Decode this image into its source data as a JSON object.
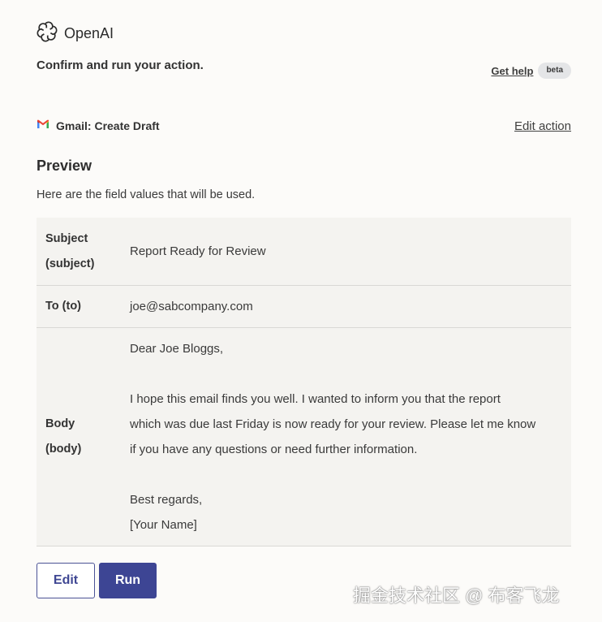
{
  "brand": {
    "name": "OpenAI",
    "icon": "openai-logo-icon"
  },
  "header": {
    "subtitle": "Confirm and run your action.",
    "help_link": "Get help",
    "beta_badge": "beta"
  },
  "action": {
    "icon": "gmail-icon",
    "title": "Gmail: Create Draft",
    "edit_link": "Edit action"
  },
  "preview": {
    "heading": "Preview",
    "description": "Here are the field values that will be used.",
    "fields": {
      "subject": {
        "label_line1": "Subject",
        "label_line2": "(subject)",
        "value": "Report Ready for Review"
      },
      "to": {
        "label": "To (to)",
        "value": "joe@sabcompany.com"
      },
      "body": {
        "label_line1": "Body",
        "label_line2": "(body)",
        "lines": [
          "Dear Joe Bloggs,",
          "",
          "I hope this email finds you well. I wanted to inform you that the report",
          "which was due last Friday is now ready for your review. Please let me know",
          "if you have any questions or need further information.",
          "",
          "Best regards,",
          "[Your Name]"
        ]
      }
    }
  },
  "buttons": {
    "edit": "Edit",
    "run": "Run"
  },
  "watermark": "掘金技术社区 @ 布客飞龙",
  "colors": {
    "accent": "#3d4594",
    "table_bg": "#f4f3f0",
    "page_bg": "#fcfbf9"
  }
}
